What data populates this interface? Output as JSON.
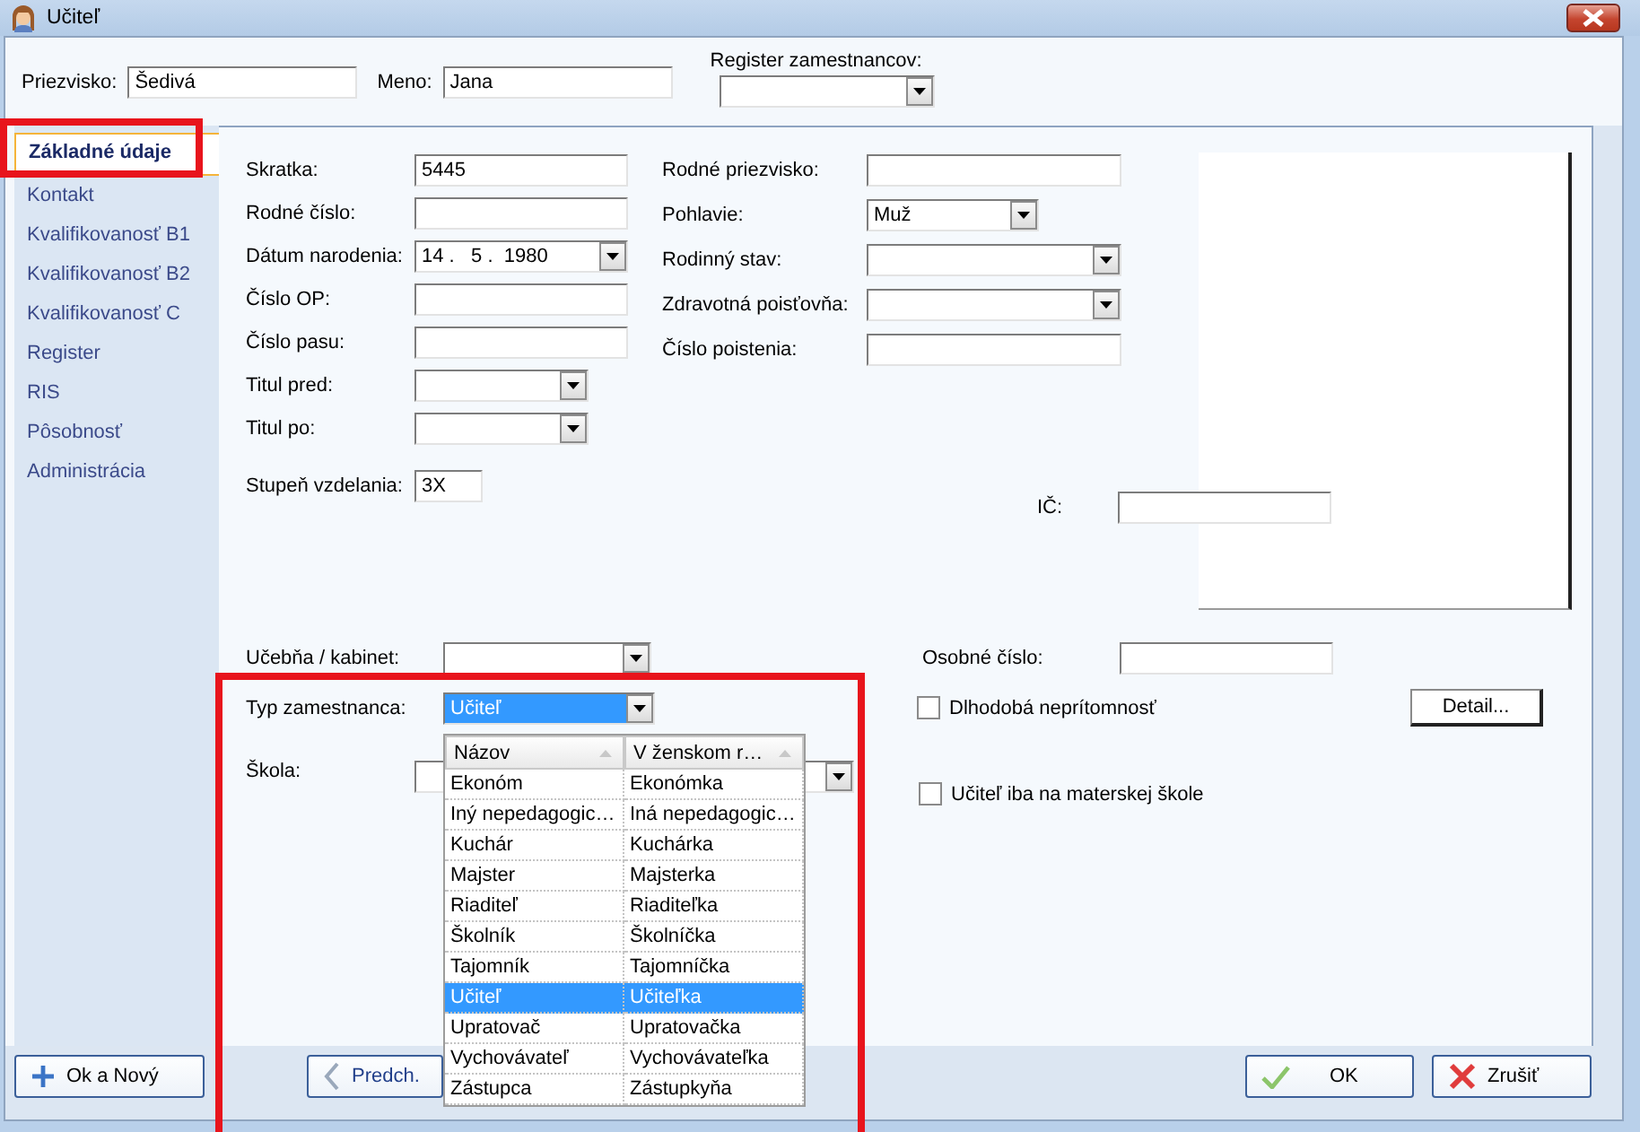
{
  "window": {
    "title": "Učiteľ"
  },
  "header": {
    "fields": [
      {
        "label": "Priezvisko:",
        "value": "Šedivá"
      },
      {
        "label": "Meno:",
        "value": "Jana"
      }
    ],
    "register": {
      "label": "Register zamestnancov:"
    }
  },
  "sidebar": {
    "items": [
      {
        "label": "Základné údaje",
        "selected": true
      },
      {
        "label": "Kontakt",
        "selected": false
      },
      {
        "label": "Kvalifikovanosť B1",
        "selected": false
      },
      {
        "label": "Kvalifikovanosť B2",
        "selected": false
      },
      {
        "label": "Kvalifikovanosť C",
        "selected": false
      },
      {
        "label": "Register",
        "selected": false
      },
      {
        "label": "RIS",
        "selected": false
      },
      {
        "label": "Pôsobnosť",
        "selected": false
      },
      {
        "label": "Administrácia",
        "selected": false
      }
    ]
  },
  "form": {
    "left": [
      {
        "kind": "text",
        "label": "Skratka:",
        "value": "5445"
      },
      {
        "kind": "text",
        "label": "Rodné číslo:"
      },
      {
        "kind": "date",
        "label": "Dátum narodenia:",
        "value": "14 .   5 .  1980"
      },
      {
        "kind": "text",
        "label": "Číslo OP:"
      },
      {
        "kind": "text",
        "label": "Číslo pasu:"
      },
      {
        "kind": "dropdown",
        "label": "Titul pred:"
      },
      {
        "kind": "dropdown",
        "label": "Titul po:"
      },
      {
        "kind": "short",
        "label": "Stupeň vzdelania:",
        "value": "3X"
      }
    ],
    "right": [
      {
        "kind": "text",
        "label": "Rodné priezvisko:"
      },
      {
        "kind": "dropdown",
        "label": "Pohlavie:",
        "value": "Muž"
      },
      {
        "kind": "dropdown",
        "label": "Rodinný stav:"
      },
      {
        "kind": "dropdown",
        "label": "Zdravotná poisťovňa:"
      },
      {
        "kind": "text",
        "label": "Číslo poistenia:"
      }
    ],
    "ico": {
      "label": "IČ:"
    },
    "classroom": {
      "label": "Učebňa / kabinet:"
    },
    "personal_number": {
      "label": "Osobné číslo:"
    },
    "employee_type": {
      "label": "Typ zamestnanca:",
      "value": "Učiteľ",
      "expanded": true
    },
    "school": {
      "label": "Škola:"
    },
    "checkboxes": [
      {
        "label": "Dlhodobá neprítomnosť",
        "checked": false
      },
      {
        "label": "Učiteľ iba na materskej škole",
        "checked": false
      }
    ],
    "detail_button": {
      "label": "Detail..."
    }
  },
  "type_list": {
    "columns": [
      "Názov",
      "V ženskom r…"
    ],
    "rows": [
      {
        "cells": [
          "Ekonóm",
          "Ekonómka"
        ],
        "selected": false
      },
      {
        "cells": [
          "Iný nepedagogic…",
          "Iná nepedagogic…"
        ],
        "selected": false
      },
      {
        "cells": [
          "Kuchár",
          "Kuchárka"
        ],
        "selected": false
      },
      {
        "cells": [
          "Majster",
          "Majsterka"
        ],
        "selected": false
      },
      {
        "cells": [
          "Riaditeľ",
          "Riaditeľka"
        ],
        "selected": false
      },
      {
        "cells": [
          "Školník",
          "Školníčka"
        ],
        "selected": false
      },
      {
        "cells": [
          "Tajomník",
          "Tajomníčka"
        ],
        "selected": false
      },
      {
        "cells": [
          "Učiteľ",
          "Učiteľka"
        ],
        "selected": true
      },
      {
        "cells": [
          "Upratovač",
          "Upratovačka"
        ],
        "selected": false
      },
      {
        "cells": [
          "Vychovávateľ",
          "Vychovávateľka"
        ],
        "selected": false
      },
      {
        "cells": [
          "Zástupca",
          "Zástupkyňa"
        ],
        "selected": false
      }
    ]
  },
  "buttons": [
    {
      "label": "Ok a Nový"
    },
    {
      "label": "Predch."
    },
    {
      "label": "OK"
    },
    {
      "label": "Zrušiť"
    }
  ]
}
